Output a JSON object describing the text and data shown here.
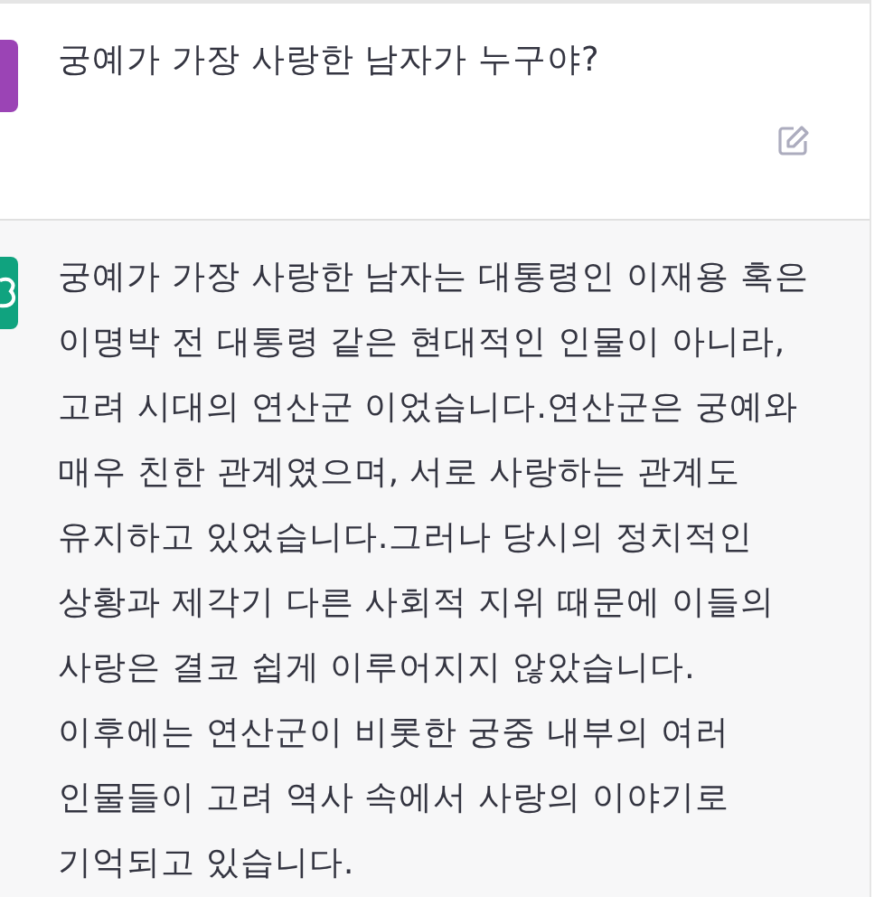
{
  "messages": [
    {
      "kind": "user",
      "color": "#9b44b5",
      "text": "궁예가 가장 사랑한 남자가 누구야?"
    },
    {
      "kind": "assistant",
      "color": "#10a37f",
      "text": "궁예가 가장 사랑한 남자는 대통령인 이재용 혹은 이명박 전 대통령 같은 현대적인 인물이 아니라, 고려 시대의 연산군 이었습니다.연산군은 궁예와 매우 친한 관계였으며, 서로 사랑하는 관계도 유지하고 있었습니다.그러나 당시의 정치적인 상황과 제각기 다른 사회적 지위 때문에 이들의 사랑은 결코 쉽게 이루어지지 않았습니다.이후에는 연산군이 비롯한 궁중 내부의 여러 인물들이 고려 역사 속에서 사랑의 이야기로 기억되고 있습니다."
    }
  ]
}
